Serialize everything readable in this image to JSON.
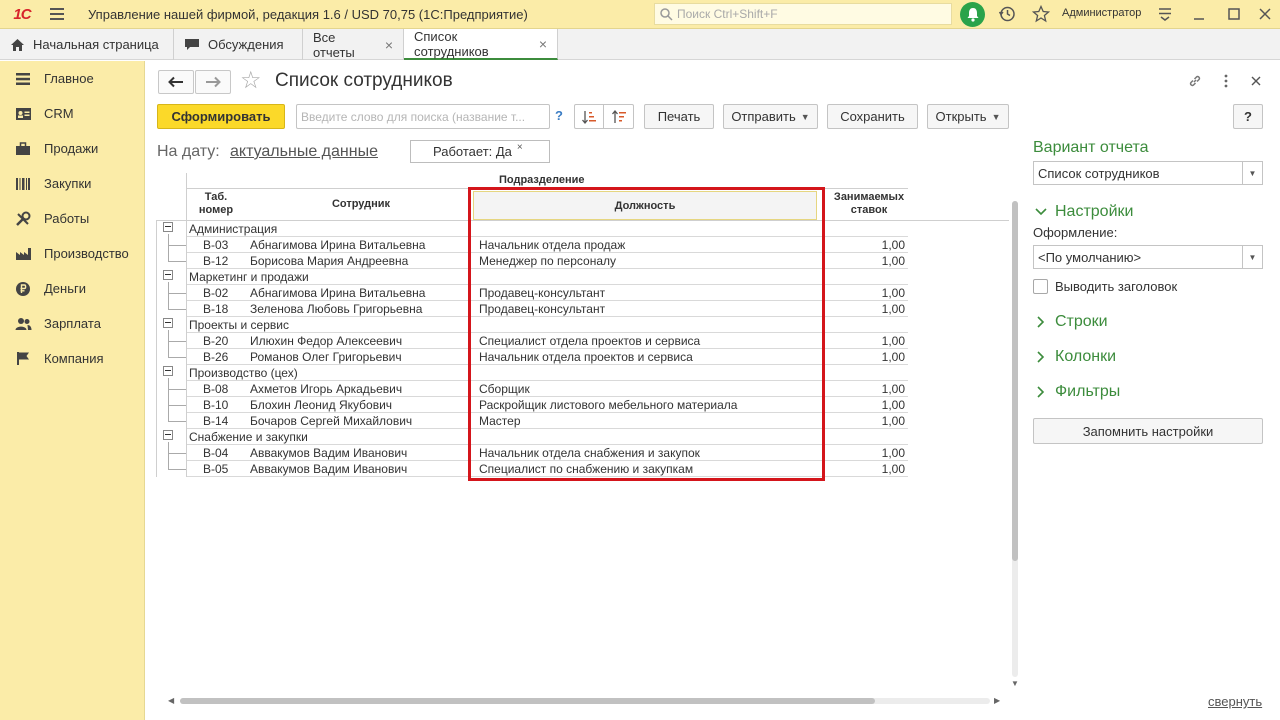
{
  "titlebar": {
    "logo": "1С",
    "title": "Управление нашей фирмой, редакция 1.6 / USD 70,75  (1С:Предприятие)",
    "search_placeholder": "Поиск Ctrl+Shift+F",
    "user": "Администратор",
    "bell_color": "#2aa34a"
  },
  "tabs": [
    {
      "label": "Начальная страница",
      "icon": "home-icon"
    },
    {
      "label": "Обсуждения",
      "icon": "chat-icon"
    },
    {
      "label": "Все отчеты",
      "close": "×"
    },
    {
      "label": "Список сотрудников",
      "close": "×",
      "active": true
    }
  ],
  "sidebar": {
    "items": [
      {
        "label": "Главное",
        "icon": "menu-icon"
      },
      {
        "label": "CRM",
        "icon": "contact-card-icon"
      },
      {
        "label": "Продажи",
        "icon": "briefcase-icon"
      },
      {
        "label": "Закупки",
        "icon": "barcode-icon"
      },
      {
        "label": "Работы",
        "icon": "tools-icon"
      },
      {
        "label": "Производство",
        "icon": "factory-icon"
      },
      {
        "label": "Деньги",
        "icon": "ruble-coin-icon"
      },
      {
        "label": "Зарплата",
        "icon": "people-icon"
      },
      {
        "label": "Компания",
        "icon": "flag-icon"
      }
    ]
  },
  "page": {
    "title": "Список сотрудников",
    "toolbar": {
      "generate": "Сформировать",
      "search_placeholder": "Введите слово для поиска (название т...",
      "help": "?",
      "print": "Печать",
      "send": "Отправить",
      "save": "Сохранить",
      "open": "Открыть",
      "help_right": "?"
    },
    "date_label": "На дату:",
    "date_value": "актуальные данные",
    "filter_chip": "Работает: Да",
    "filter_chip_close": "×"
  },
  "report": {
    "header_group": "Подразделение",
    "columns": {
      "tab_num": "Таб. номер",
      "employee": "Сотрудник",
      "position": "Должность",
      "rates": "Занимаемых ставок"
    },
    "groups": [
      {
        "name": "Администрация",
        "rows": [
          {
            "num": "В-03",
            "name": "Абнагимова Ирина Витальевна",
            "position": "Начальник отдела продаж",
            "rate": "1,00"
          },
          {
            "num": "В-12",
            "name": "Борисова Мария Андреевна",
            "position": "Менеджер по персоналу",
            "rate": "1,00"
          }
        ]
      },
      {
        "name": "Маркетинг и продажи",
        "rows": [
          {
            "num": "В-02",
            "name": "Абнагимова Ирина Витальевна",
            "position": "Продавец-консультант",
            "rate": "1,00"
          },
          {
            "num": "В-18",
            "name": "Зеленова Любовь Григорьевна",
            "position": "Продавец-консультант",
            "rate": "1,00"
          }
        ]
      },
      {
        "name": "Проекты и сервис",
        "rows": [
          {
            "num": "В-20",
            "name": "Илюхин Федор Алексеевич",
            "position": "Специалист отдела проектов и сервиса",
            "rate": "1,00"
          },
          {
            "num": "В-26",
            "name": "Романов Олег Григорьевич",
            "position": "Начальник отдела проектов и сервиса",
            "rate": "1,00"
          }
        ]
      },
      {
        "name": "Производство (цех)",
        "rows": [
          {
            "num": "В-08",
            "name": "Ахметов Игорь Аркадьевич",
            "position": "Сборщик",
            "rate": "1,00"
          },
          {
            "num": "В-10",
            "name": "Блохин Леонид Якубович",
            "position": "Раскройщик листового мебельного материала",
            "rate": "1,00"
          },
          {
            "num": "В-14",
            "name": "Бочаров Сергей Михайлович",
            "position": "Мастер",
            "rate": "1,00"
          }
        ]
      },
      {
        "name": "Снабжение и закупки",
        "rows": [
          {
            "num": "В-04",
            "name": "Аввакумов Вадим Иванович",
            "position": "Начальник отдела снабжения и закупок",
            "rate": "1,00"
          },
          {
            "num": "В-05",
            "name": "Аввакумов Вадим Иванович",
            "position": "Специалист по снабжению и закупкам",
            "rate": "1,00"
          }
        ]
      }
    ],
    "highlight_color": "#d4151b"
  },
  "right_panel": {
    "variant_title": "Вариант отчета",
    "variant_value": "Список сотрудников",
    "settings": "Настройки",
    "format_label": "Оформление:",
    "format_value": "<По умолчанию>",
    "show_header": "Выводить заголовок",
    "rows": "Строки",
    "columns": "Колонки",
    "filters": "Фильтры",
    "remember": "Запомнить настройки",
    "collapse": "свернуть",
    "accent": "#3c8c3c"
  }
}
